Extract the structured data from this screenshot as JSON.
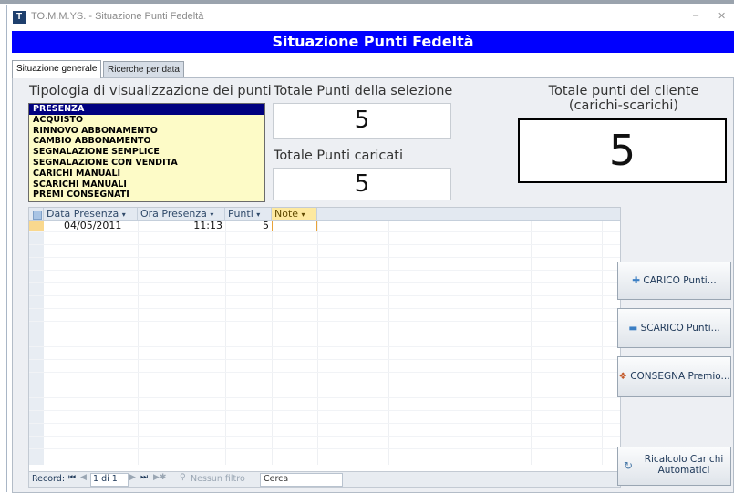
{
  "window": {
    "title": "TO.M.M.YS. - Situazione Punti Fedeltà",
    "minimize": "–",
    "close": "✕"
  },
  "header": {
    "title": "Situazione Punti Fedeltà"
  },
  "tabs": [
    {
      "label": "Situazione generale"
    },
    {
      "label": "Ricerche per data"
    }
  ],
  "tipologia": {
    "label": "Tipologia di visualizzazione dei punti",
    "items": [
      "PRESENZA",
      "ACQUISTO",
      "RINNOVO ABBONAMENTO",
      "CAMBIO ABBONAMENTO",
      "SEGNALAZIONE SEMPLICE",
      "SEGNALAZIONE CON VENDITA",
      "CARICHI MANUALI",
      "SCARICHI MANUALI",
      "PREMI CONSEGNATI"
    ],
    "selected": "PRESENZA"
  },
  "totale_selezione": {
    "label": "Totale Punti della selezione",
    "value": "5"
  },
  "totale_caricati": {
    "label": "Totale Punti caricati",
    "value": "5"
  },
  "totale_cliente": {
    "label_line1": "Totale punti del cliente",
    "label_line2": "(carichi-scarichi)",
    "value": "5"
  },
  "table": {
    "columns": [
      "Data Presenza",
      "Ora Presenza",
      "Punti",
      "Note"
    ],
    "rows": [
      {
        "data": "04/05/2011",
        "ora": "11:13",
        "punti": "5",
        "note": ""
      }
    ]
  },
  "navigator": {
    "record_label": "Record:",
    "position": "1 di 1",
    "filter_label": "Nessun filtro",
    "search_label": "Cerca"
  },
  "buttons": {
    "carico": "CARICO Punti...",
    "scarico": "SCARICO Punti...",
    "consegna": "CONSEGNA Premio...",
    "ricalcolo_line1": "Ricalcolo Carichi",
    "ricalcolo_line2": "Automatici"
  }
}
